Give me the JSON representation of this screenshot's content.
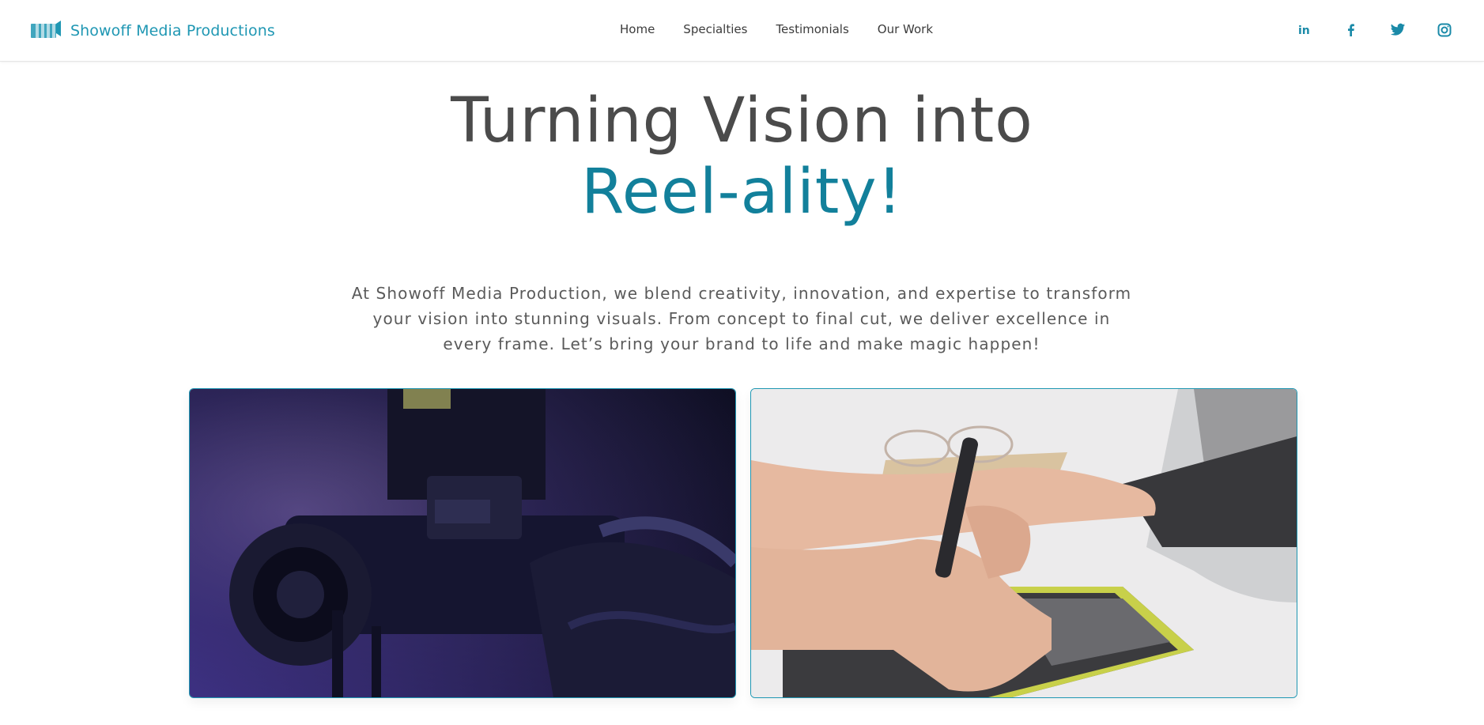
{
  "brand": {
    "name": "Showoff Media Productions",
    "logo_icon": "film-clapper-icon"
  },
  "nav": {
    "items": [
      "Home",
      "Specialties",
      "Testimonials",
      "Our Work"
    ]
  },
  "social": [
    {
      "icon": "linkedin-icon",
      "glyph": "in"
    },
    {
      "icon": "facebook-icon",
      "glyph": "f"
    },
    {
      "icon": "twitter-icon",
      "glyph": "🐦"
    },
    {
      "icon": "instagram-icon",
      "glyph": "◎"
    }
  ],
  "hero": {
    "title_line1": "Turning Vision into",
    "title_line2": "Reel-ality!",
    "lead": "At Showoff Media Production, we blend creativity, innovation, and expertise to transform your vision into stunning visuals. From concept to final cut, we deliver excellence in every frame. Let’s bring your brand to life and make magic happen!"
  },
  "colors": {
    "accent": "#1f97b3",
    "accent_dark": "#12809b",
    "heading": "#4b4b4b"
  },
  "images": [
    {
      "subject": "professional video camera close-up"
    },
    {
      "subject": "hands using drawing tablet beside laptop"
    }
  ]
}
